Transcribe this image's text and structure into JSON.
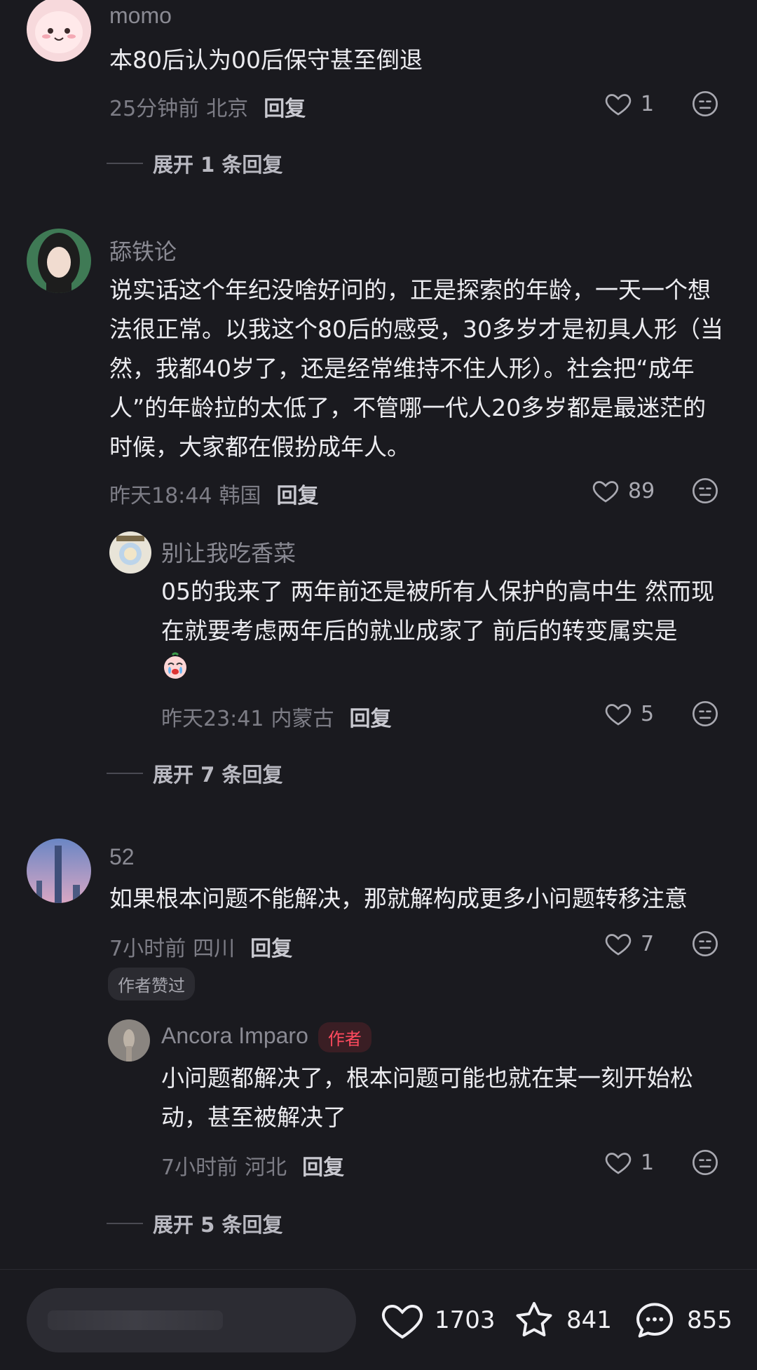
{
  "comments": [
    {
      "user": "momo",
      "text": "本80后认为00后保守甚至倒退",
      "time": "25分钟前",
      "location": "北京",
      "reply_label": "回复",
      "likes": "1",
      "expand": "展开 1 条回复"
    },
    {
      "user": "舔铁论",
      "text": "说实话这个年纪没啥好问的，正是探索的年龄，一天一个想法很正常。以我这个80后的感受，30多岁才是初具人形（当然，我都40岁了，还是经常维持不住人形）。社会把“成年人”的年龄拉的太低了，不管哪一代人20多岁都是最迷茫的时候，大家都在假扮成年人。",
      "time": "昨天18:44",
      "location": "韩国",
      "reply_label": "回复",
      "likes": "89",
      "reply": {
        "user": "别让我吃香菜",
        "text": "05的我来了 两年前还是被所有人保护的高中生 然而现在就要考虑两年后的就业成家了 前后的转变属实是",
        "time": "昨天23:41",
        "location": "内蒙古",
        "reply_label": "回复",
        "likes": "5"
      },
      "expand": "展开 7 条回复"
    },
    {
      "user": "52",
      "text": "如果根本问题不能解决，那就解构成更多小问题转移注意",
      "time": "7小时前",
      "location": "四川",
      "reply_label": "回复",
      "likes": "7",
      "badge": "作者赞过",
      "reply": {
        "user": "Ancora Imparo",
        "tag": "作者",
        "text": "小问题都解决了，根本问题可能也就在某一刻开始松动，甚至被解决了",
        "time": "7小时前",
        "location": "河北",
        "reply_label": "回复",
        "likes": "1"
      },
      "expand": "展开 5 条回复"
    }
  ],
  "bottom_bar": {
    "likes": "1703",
    "favorites": "841",
    "comments": "855"
  },
  "icons": {
    "like": "heart-outline-icon",
    "dislike": "neutral-face-icon",
    "favorite": "star-outline-icon",
    "comment": "chat-bubble-icon"
  },
  "colors": {
    "background": "#1a1a1f",
    "author_tag": "#ff4a5e"
  }
}
